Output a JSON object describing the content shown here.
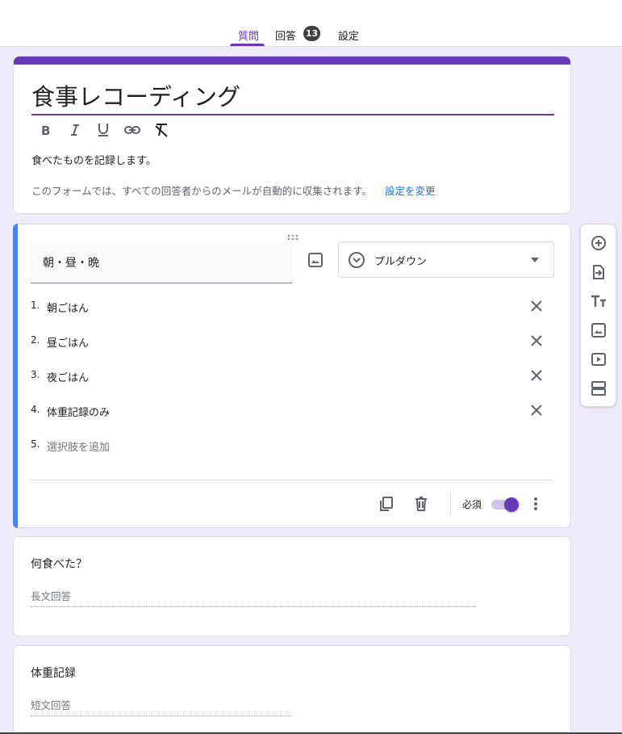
{
  "tabs": {
    "questions": "質問",
    "responses": "回答",
    "responses_count": "13",
    "settings": "設定"
  },
  "header_card": {
    "title": "食事レコーディング",
    "description": "食べたものを記録します。",
    "email_note": "このフォームでは、すべての回答者からのメールが自動的に収集されます。",
    "email_link": "設定を変更",
    "format_icons": [
      "bold-icon",
      "italic-icon",
      "underline-icon",
      "link-icon",
      "clear-format-icon"
    ]
  },
  "active_question": {
    "title": "朝・昼・晩",
    "type_label": "プルダウン",
    "options": [
      {
        "num": "1.",
        "label": "朝ごはん"
      },
      {
        "num": "2.",
        "label": "昼ごはん"
      },
      {
        "num": "3.",
        "label": "夜ごはん"
      },
      {
        "num": "4.",
        "label": "体重記録のみ"
      }
    ],
    "add_option_num": "5.",
    "add_option_label": "選択肢を追加",
    "required_label": "必須",
    "required_on": true
  },
  "question2": {
    "title": "何食べた？",
    "placeholder": "長文回答"
  },
  "question3": {
    "title": "体重記録",
    "placeholder": "短文回答"
  },
  "side_toolbar": [
    "add-question-icon",
    "import-questions-icon",
    "add-title-icon",
    "add-image-icon",
    "add-video-icon",
    "add-section-icon"
  ],
  "colors": {
    "theme": "#673ab7",
    "background": "#f0ebf8",
    "active_bar": "#4285f4",
    "link": "#1a73e8"
  }
}
